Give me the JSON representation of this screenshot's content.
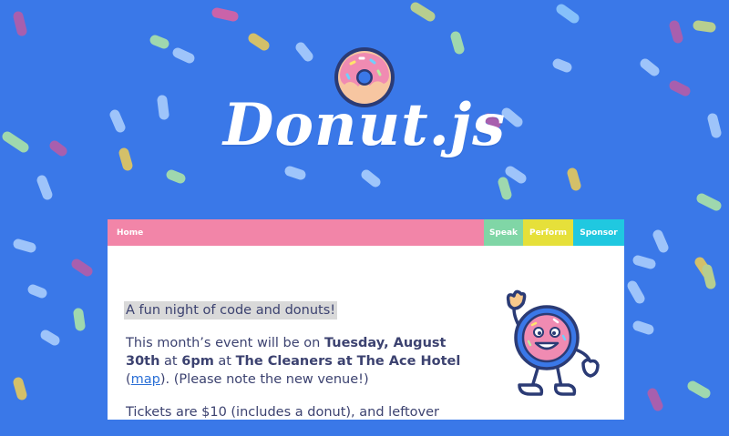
{
  "logo": {
    "title": "Donut.js"
  },
  "nav": {
    "home": "Home",
    "speak": "Speak",
    "perform": "Perform",
    "sponsor": "Sponsor"
  },
  "content": {
    "tagline": "A fun night of code and donuts!",
    "p1_a": "This month’s event will be on ",
    "p1_date": "Tuesday, August 30th",
    "p1_b": " at ",
    "p1_time": "6pm",
    "p1_c": " at ",
    "p1_venue": "The Cleaners at The Ace Hotel",
    "p1_d": " (",
    "p1_map": "map",
    "p1_e": "). (Please note the new venue!)",
    "p2": "Tickets are $10 (includes a donut), and leftover"
  },
  "colors": {
    "background": "#3a78e8",
    "home_tab": "#f285a8",
    "speak_tab": "#80d6a6",
    "perform_tab": "#e6e03a",
    "sponsor_tab": "#20c8e0",
    "text": "#3c4270",
    "link": "#2a6fd6"
  }
}
